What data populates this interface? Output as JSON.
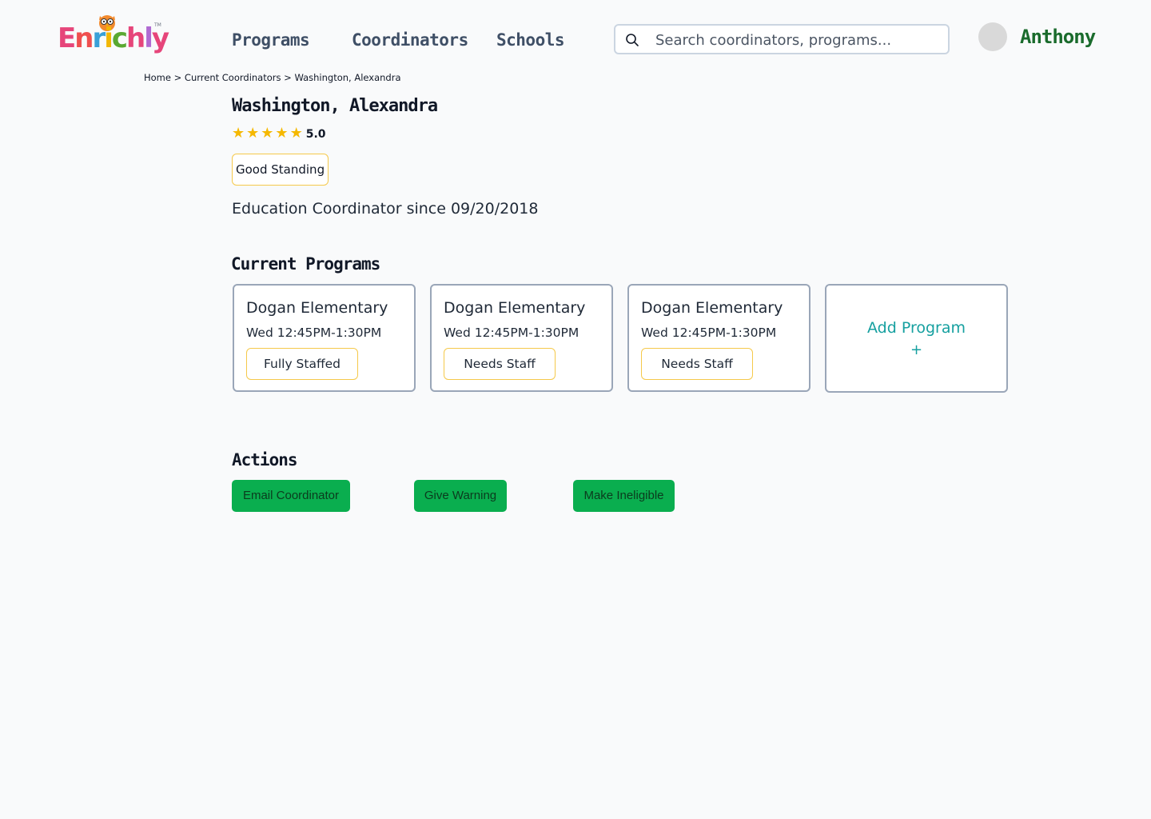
{
  "header": {
    "logo_text": "Enrichly",
    "logo_tm": "TM",
    "nav": {
      "programs": "Programs",
      "coordinators": "Coordinators",
      "schools": "Schools"
    },
    "search": {
      "placeholder": "Search coordinators, programs..."
    },
    "user": {
      "name": "Anthony"
    }
  },
  "breadcrumb": {
    "home": "Home",
    "separator": ">",
    "current_coordinators": "Current Coordinators",
    "current": "Washington, Alexandra"
  },
  "coordinator": {
    "name": "Washington, Alexandra",
    "rating_stars": 5,
    "rating": "5.0",
    "standing": "Good Standing",
    "since": "Education Coordinator since 09/20/2018"
  },
  "programs_section": {
    "title": "Current Programs",
    "programs": [
      {
        "school": "Dogan Elementary",
        "time": "Wed 12:45PM-1:30PM",
        "status": "Fully Staffed"
      },
      {
        "school": "Dogan Elementary",
        "time": "Wed 12:45PM-1:30PM",
        "status": "Needs Staff"
      },
      {
        "school": "Dogan Elementary",
        "time": "Wed 12:45PM-1:30PM",
        "status": "Needs Staff"
      }
    ],
    "add_label": "Add Program",
    "add_plus": "+"
  },
  "actions_section": {
    "title": "Actions",
    "email": "Email Coordinator",
    "warning": "Give Warning",
    "ineligible": "Make Ineligible"
  },
  "colors": {
    "accent_green": "#0aae4f",
    "badge_border": "#f5c94b",
    "star": "#f5b800",
    "add_teal": "#16a0a0",
    "user_green": "#1a6b2c"
  },
  "icons": {
    "search": "search-icon",
    "star": "star-icon",
    "logo_mascot": "owl-icon"
  }
}
